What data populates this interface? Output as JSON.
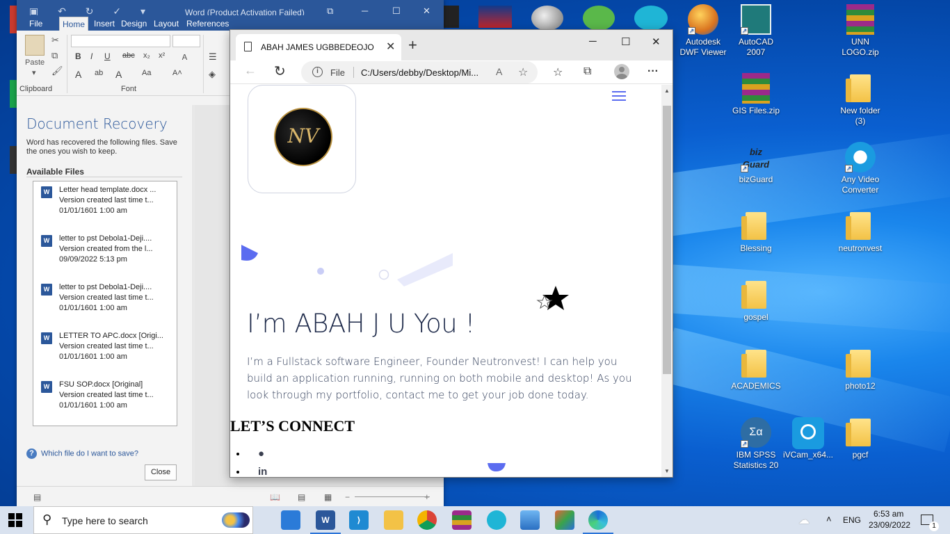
{
  "desktop": {
    "icons": [
      {
        "id": "autodesk-dwf",
        "label": "Autodesk\nDWF Viewer",
        "kind": "app",
        "color": "#d99a1f"
      },
      {
        "id": "autocad",
        "label": "AutoCAD\n2007",
        "kind": "app",
        "color": "#1f7a7a"
      },
      {
        "id": "unn-logo",
        "label": "UNN\nLOGO.zip",
        "kind": "zip",
        "color": "#9b2a8a"
      },
      {
        "id": "gis-files",
        "label": "GIS Files.zip",
        "kind": "zip",
        "color": "#9b2a8a"
      },
      {
        "id": "new-folder",
        "label": "New folder\n(3)",
        "kind": "folder"
      },
      {
        "id": "bizguard",
        "label": "bizGuard",
        "kind": "app",
        "color": "#333"
      },
      {
        "id": "any-video",
        "label": "Any Video\nConverter",
        "kind": "app",
        "color": "#1a9be0"
      },
      {
        "id": "blessing",
        "label": "Blessing",
        "kind": "folder"
      },
      {
        "id": "neutronvest",
        "label": "neutronvest",
        "kind": "folder"
      },
      {
        "id": "gospel",
        "label": "gospel",
        "kind": "folder"
      },
      {
        "id": "academics",
        "label": "ACADEMICS",
        "kind": "folder"
      },
      {
        "id": "photo12",
        "label": "photo12",
        "kind": "folder"
      },
      {
        "id": "spss",
        "label": "IBM SPSS\nStatistics 20",
        "kind": "app",
        "color": "#2e6da4"
      },
      {
        "id": "ivcam",
        "label": "iVCam_x64...",
        "kind": "app",
        "color": "#1a9be0"
      },
      {
        "id": "pgcf",
        "label": "pgcf",
        "kind": "folder"
      }
    ]
  },
  "word": {
    "caption": "Word (Product Activation Failed)",
    "tabs": [
      "File",
      "Home",
      "Insert",
      "Design",
      "Layout",
      "References"
    ],
    "active_tab": "Home",
    "ribbon": {
      "paste": "Paste",
      "clipboard": "Clipboard",
      "font": "Font"
    },
    "recovery": {
      "title": "Document Recovery",
      "desc": "Word has recovered the following files. Save the ones you wish to keep.",
      "available": "Available Files",
      "files": [
        {
          "name": "Letter head template.docx ...",
          "note": "Version created last time t...",
          "date": "01/01/1601 1:00 am"
        },
        {
          "name": "letter to pst Debola1-Deji.... ",
          "note": "Version created from the l...",
          "date": "09/09/2022 5:13 pm"
        },
        {
          "name": "letter to pst Debola1-Deji.... ",
          "note": "Version created last time t...",
          "date": "01/01/1601 1:00 am"
        },
        {
          "name": "LETTER TO APC.docx  [Origi...",
          "note": "Version created last time t...",
          "date": "01/01/1601 1:00 am"
        },
        {
          "name": "FSU SOP.docx  [Original]",
          "note": "Version created last time t...",
          "date": "01/01/1601 1:00 am"
        }
      ],
      "help": "Which file do I want to save?",
      "close": "Close"
    }
  },
  "edge": {
    "tab_title": "ABAH JAMES UGBBEDEOJO",
    "url_scheme": "File",
    "url": "C:/Users/debby/Desktop/Mi...",
    "page": {
      "logo_text": "NV",
      "heading": "I’m ABAH J U You !",
      "intro": "I’m a Fullstack software Engineer, Founder Neutronvest! I can help you build an application running, running on both mobile and desktop! As you look through my portfolio, contact me to get your job done today.",
      "connect": "LET’S CONNECT",
      "socials": [
        "github-icon",
        "linkedin-icon"
      ]
    }
  },
  "taskbar": {
    "search_placeholder": "Type here to search",
    "lang": "ENG",
    "time": "6:53 am",
    "date": "23/09/2022",
    "notifications": "1"
  },
  "colors": {
    "word_blue": "#2b579a",
    "accent": "#5b6cf0",
    "hero_text": "#1e2a4a"
  }
}
